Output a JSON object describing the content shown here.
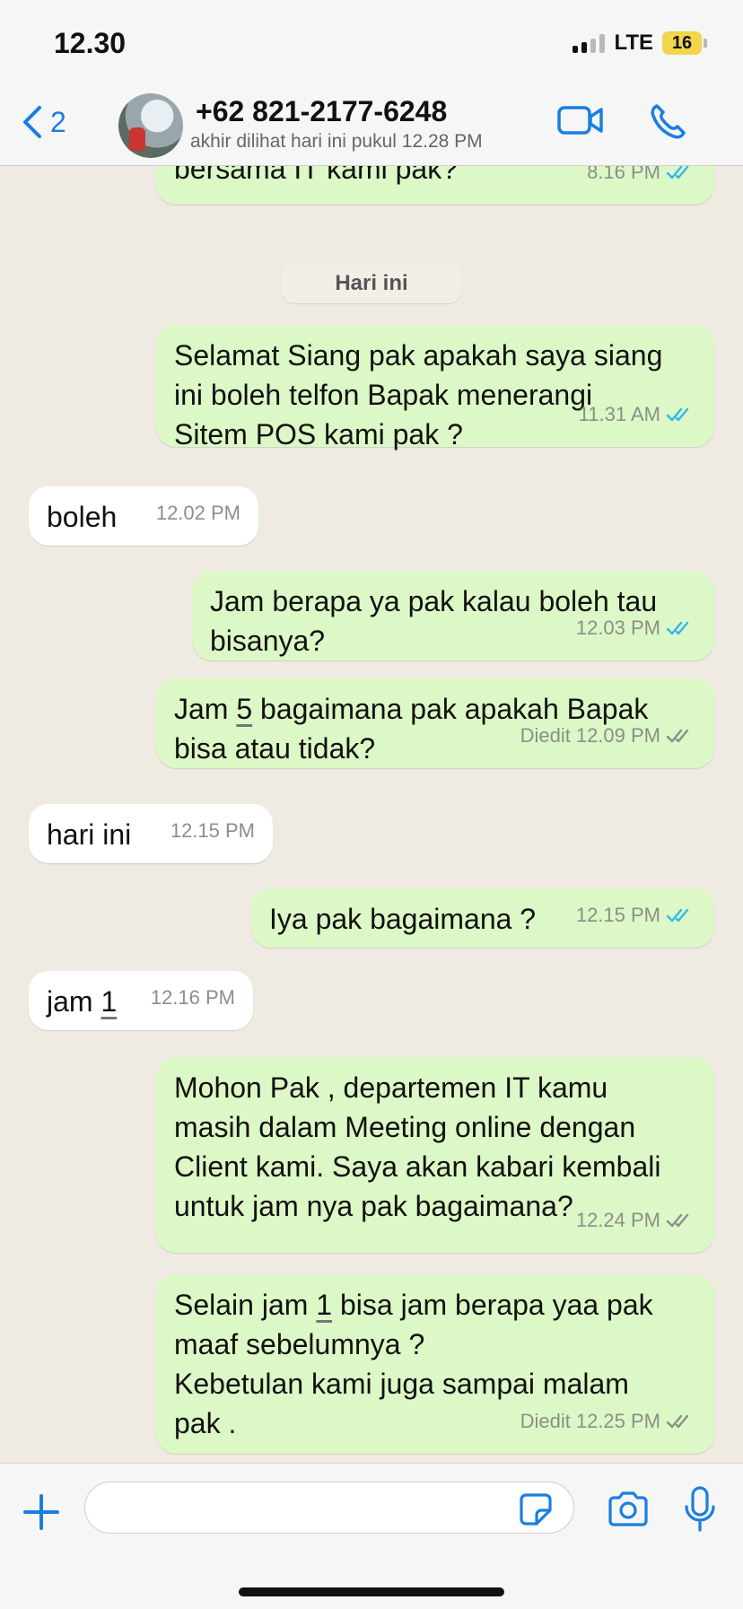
{
  "status_bar": {
    "time": "12.30",
    "network": "LTE",
    "battery": "16"
  },
  "header": {
    "back_count": "2",
    "contact_name": "+62 821-2177-6248",
    "last_seen": "akhir dilihat hari ini pukul 12.28 PM"
  },
  "chat": {
    "partial_message": {
      "text": "bersama IT kami pak?",
      "time": "8.16 PM"
    },
    "date_separator": "Hari ini",
    "messages": [
      {
        "dir": "out",
        "lines": [
          "Selamat Siang pak apakah saya siang",
          "ini boleh telfon Bapak menerangi",
          "Sitem POS kami pak ?"
        ],
        "time": "11.31 AM",
        "edited": "",
        "read": true
      },
      {
        "dir": "in",
        "lines": [
          "boleh"
        ],
        "time": "12.02 PM"
      },
      {
        "dir": "out",
        "lines": [
          "Jam berapa ya pak kalau boleh tau",
          "bisanya?"
        ],
        "time": "12.03 PM",
        "edited": "",
        "read": true
      },
      {
        "dir": "out",
        "lines": [
          "Jam 5 bagaimana pak apakah Bapak",
          "bisa atau tidak?"
        ],
        "time": "12.09 PM",
        "edited": "Diedit",
        "read": false
      },
      {
        "dir": "in",
        "lines": [
          "hari ini"
        ],
        "time": "12.15 PM"
      },
      {
        "dir": "out",
        "lines": [
          "Iya pak bagaimana ?"
        ],
        "time": "12.15 PM",
        "edited": "",
        "read": true
      },
      {
        "dir": "in",
        "lines": [
          "jam 1"
        ],
        "time": "12.16 PM"
      },
      {
        "dir": "out",
        "lines": [
          "Mohon Pak , departemen IT kamu",
          "masih dalam Meeting online dengan",
          "Client kami. Saya akan kabari kembali",
          "untuk jam nya pak bagaimana?"
        ],
        "time": "12.24 PM",
        "edited": "",
        "read": false
      },
      {
        "dir": "out",
        "lines": [
          "Selain jam 1 bisa jam berapa yaa pak",
          "maaf sebelumnya ?",
          "Kebetulan kami juga sampai malam",
          "pak ."
        ],
        "time": "12.25 PM",
        "edited": "Diedit",
        "read": false
      }
    ]
  },
  "composer": {
    "input_value": ""
  },
  "colors": {
    "accent": "#1a7ee0",
    "outgoing": "#dcf8c6",
    "incoming": "#ffffff",
    "read_tick": "#34b7f1",
    "unread_tick": "#8a8f8a"
  }
}
